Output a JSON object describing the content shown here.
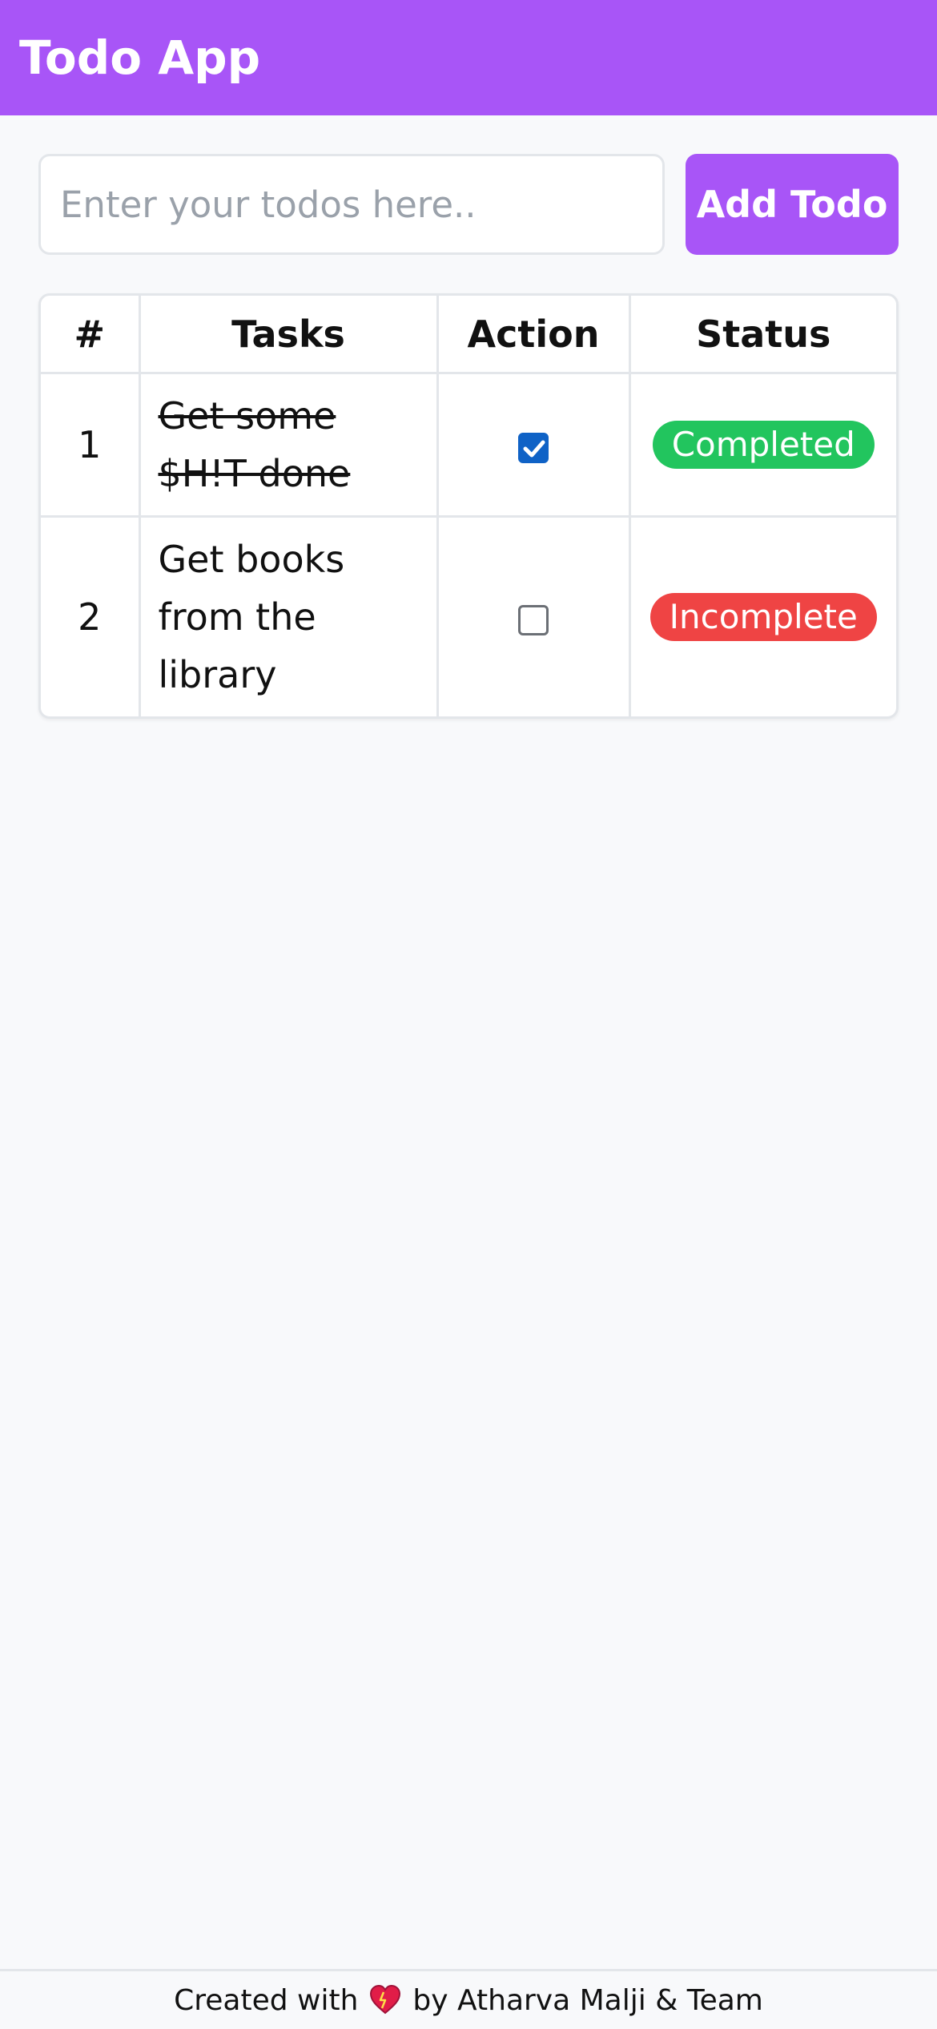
{
  "header": {
    "title": "Todo App",
    "bg_color": "#a855f7"
  },
  "add_form": {
    "input_placeholder": "Enter your todos here..",
    "input_value": "",
    "button_label": "Add Todo"
  },
  "table": {
    "columns": [
      "#",
      "Tasks",
      "Action",
      "Status"
    ],
    "rows": [
      {
        "num": "1",
        "task": "Get some $H!T done",
        "checked": true,
        "status": "Completed",
        "status_color": "#22c55e"
      },
      {
        "num": "2",
        "task": "Get books from the library",
        "checked": false,
        "status": "Incomplete",
        "status_color": "#ef4444"
      }
    ]
  },
  "footer": {
    "prefix": "Created with",
    "icon": "heart-icon",
    "suffix": "by Atharva Malji & Team"
  }
}
